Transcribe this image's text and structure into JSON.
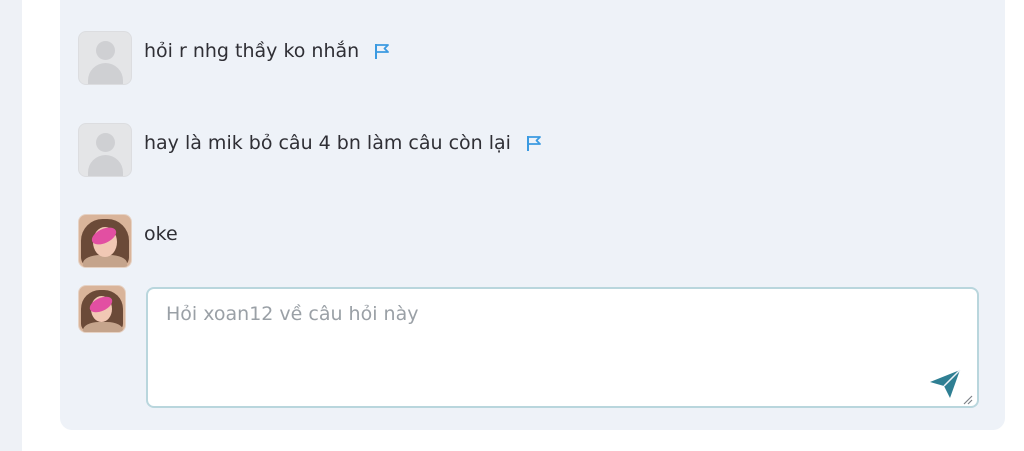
{
  "comments": [
    {
      "text": "hỏi r nhg thầy ko nhắn",
      "avatar": "default-user-avatar",
      "flag": true
    },
    {
      "text": "hay là mik bỏ câu 4 bn làm câu còn lại",
      "avatar": "default-user-avatar",
      "flag": true
    },
    {
      "text": "oke",
      "avatar": "user-photo-avatar",
      "flag": false
    }
  ],
  "composer": {
    "placeholder": "Hỏi xoan12 về câu hỏi này",
    "value": ""
  },
  "icons": {
    "flag": "flag-icon",
    "send": "send-icon"
  },
  "colors": {
    "panel_background": "#eef2f8",
    "flag_blue": "#3b9ae1",
    "send_teal": "#2f7f93",
    "input_border": "#b9d6dd"
  }
}
